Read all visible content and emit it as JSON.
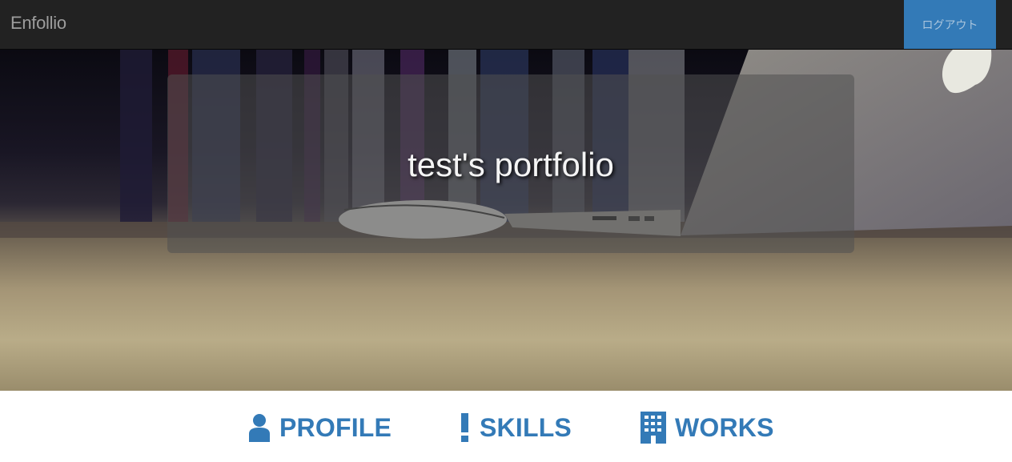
{
  "navbar": {
    "brand": "Enfollio",
    "logout_label": "ログアウト"
  },
  "hero": {
    "title": "test's portfolio"
  },
  "tabs": [
    {
      "label": "PROFILE",
      "icon": "user-icon"
    },
    {
      "label": "SKILLS",
      "icon": "exclamation-icon"
    },
    {
      "label": "WORKS",
      "icon": "building-icon"
    }
  ],
  "colors": {
    "navbar_bg": "#222222",
    "brand_text": "#9d9d9d",
    "accent": "#337ab7"
  }
}
